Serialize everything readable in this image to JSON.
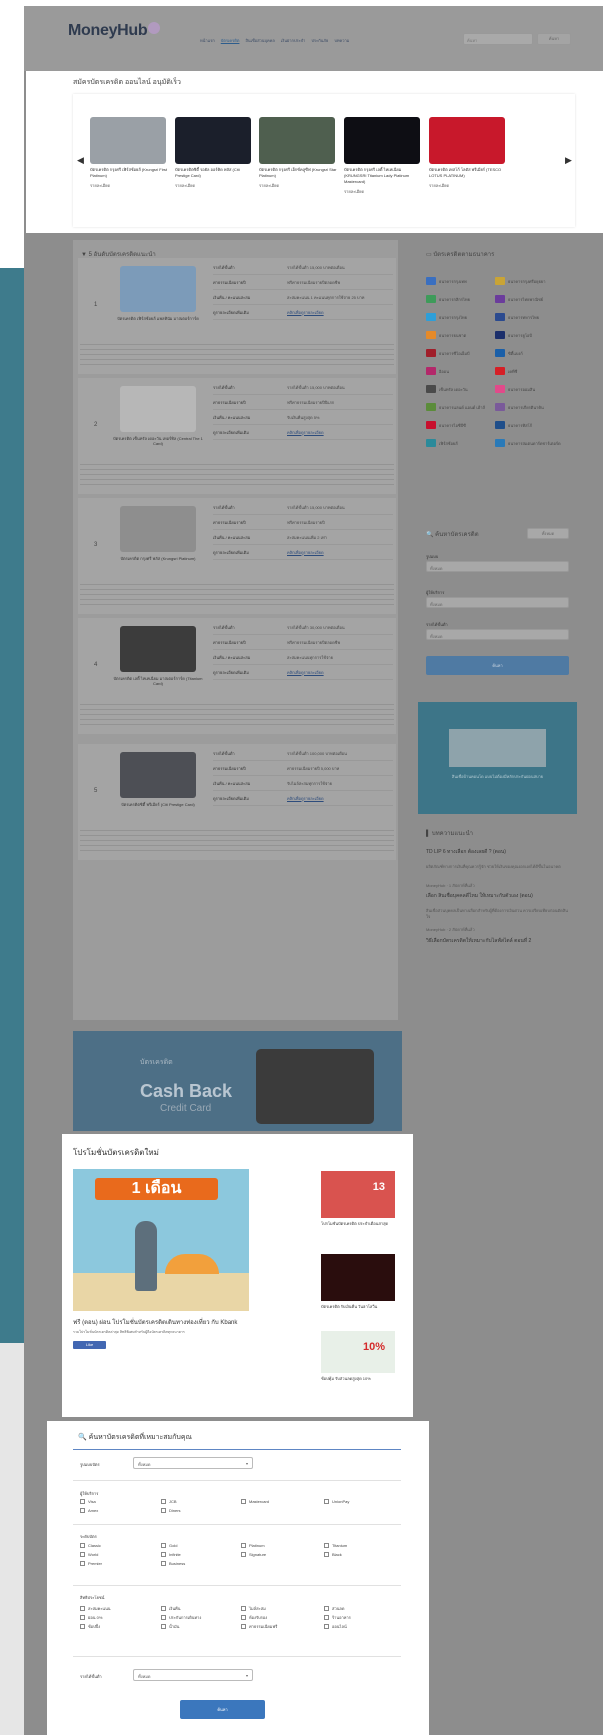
{
  "header": {
    "logo": "MoneyHub",
    "nav": [
      "หน้าแรก",
      "บัตรเครดิต",
      "สินเชื่อส่วนบุคคล",
      "เงินฝากประจำ",
      "ประกันภัย",
      "บทความ"
    ],
    "nav_active": 1,
    "search_placeholder": "ค้นหา",
    "search_button": "ค้นหา"
  },
  "carousel": {
    "title": "สมัครบัตรเครดิต ออนไลน์ อนุมัติเร็ว",
    "detail_label": "รายละเอียด",
    "items": [
      {
        "name": "บัตรเครดิต กรุงศรี เฟิร์สช้อยส์ (Krungsri First Platinum)",
        "color": "#9aa0a6"
      },
      {
        "name": "บัตรเครดิตซิตี้ รอยัล ออร์คิด พลัส (Citi Prestige Card)",
        "color": "#1b1f2b"
      },
      {
        "name": "บัตรเครดิต กรุงศรี เอ็กซ์คลูซีฟ (Krungsri Star Platinum)",
        "color": "#4f5f4f"
      },
      {
        "name": "บัตรเครดิต กรุงศรี เลดี้ ไทเทเนียม (KRUNGSRI Titanium Lady Platinum Mastercard)",
        "color": "#0e0e14"
      },
      {
        "name": "บัตรเครดิต เทสโก้ โลตัส พรีเมียร์ (TESCO LOTUS PLATINUM)",
        "color": "#c8182b"
      }
    ]
  },
  "main": {
    "title": "5 อันดับบัตรเครดิตแนะนำ",
    "row_labels": [
      "รายได้ขั้นต่ำ",
      "ค่าธรรมเนียมรายปี",
      "เงินคืน / คะแนนสะสม",
      "ดูรายละเอียดเพิ่มเติม"
    ],
    "ranks": [
      {
        "num": "1",
        "name": "บัตรเครดิต เฟิร์สช้อยส์ แพลทินัม มาสเตอร์การ์ด",
        "card_color": "#7c9bb9",
        "values": [
          "รายได้ขั้นต่ำ 15,000 บาทต่อเดือน",
          "ฟรีค่าธรรมเนียมรายปีตลอดชีพ",
          "สะสมคะแนน 1 คะแนนทุกการใช้จ่าย 25 บาท",
          "คลิกเพื่อดูรายละเอียด"
        ]
      },
      {
        "num": "2",
        "name": "บัตรเครดิต เซ็นทรัล เดอะวัน เทอร์ทิล (Central The 1 Card)",
        "card_color": "#b7b7b7",
        "values": [
          "รายได้ขั้นต่ำ 15,000 บาทต่อเดือน",
          "ฟรีค่าธรรมเนียมรายปีปีแรก",
          "รับเงินคืนสูงสุด 5%",
          "คลิกเพื่อดูรายละเอียด"
        ]
      },
      {
        "num": "3",
        "name": "บัตรเครดิต กรุงศรี พลัส (Krungsri Platinum)",
        "card_color": "#8e8e8e",
        "values": [
          "รายได้ขั้นต่ำ 15,000 บาทต่อเดือน",
          "ฟรีค่าธรรมเนียมรายปี",
          "สะสมคะแนนเพิ่ม 2 เท่า",
          "คลิกเพื่อดูรายละเอียด"
        ]
      },
      {
        "num": "4",
        "name": "บัตรเครดิต เลดี้ ไทเทเนียม มาสเตอร์การ์ด (Titanium Card)",
        "card_color": "#3c3c3c",
        "values": [
          "รายได้ขั้นต่ำ 30,000 บาทต่อเดือน",
          "ฟรีค่าธรรมเนียมรายปีตลอดชีพ",
          "สะสมคะแนนทุกการใช้จ่าย",
          "คลิกเพื่อดูรายละเอียด"
        ]
      },
      {
        "num": "5",
        "name": "บัตรเครดิตซิตี้ พรีเมียร์ (Citi Prestige Card)",
        "card_color": "#4d4f55",
        "values": [
          "รายได้ขั้นต่ำ 100,000 บาทต่อเดือน",
          "ค่าธรรมเนียมรายปี 5,000 บาท",
          "รับไมล์สะสมทุกการใช้จ่าย",
          "คลิกเพื่อดูรายละเอียด"
        ]
      }
    ]
  },
  "cashback": {
    "small": "บัตรเครดิต",
    "big": "Cash Back",
    "sub": "Credit Card"
  },
  "sidebar": {
    "banks_title": "บัตรเครดิตตามธนาคาร",
    "banks": [
      {
        "name": "ธนาคารกรุงเทพ",
        "color": "#3a6fc0"
      },
      {
        "name": "ธนาคารกรุงศรีอยุธยา",
        "color": "#c9a436"
      },
      {
        "name": "ธนาคารกสิกรไทย",
        "color": "#3e9b5a"
      },
      {
        "name": "ธนาคารไทยพาณิชย์",
        "color": "#6b3c9c"
      },
      {
        "name": "ธนาคารกรุงไทย",
        "color": "#2e9fd9"
      },
      {
        "name": "ธนาคารทหารไทย",
        "color": "#2b4a8f"
      },
      {
        "name": "ธนาคารธนชาต",
        "color": "#e58a2a"
      },
      {
        "name": "ธนาคารยูโอบี",
        "color": "#1c2f6b"
      },
      {
        "name": "ธนาคารซีไอเอ็มบี",
        "color": "#a01e2a"
      },
      {
        "name": "ซิตี้แบงก์",
        "color": "#1a5fa8"
      },
      {
        "name": "อิออน",
        "color": "#b3286a"
      },
      {
        "name": "เคทีซี",
        "color": "#d61f26"
      },
      {
        "name": "เซ็นทรัล เดอะวัน",
        "color": "#4a4a4a"
      },
      {
        "name": "ธนาคารออมสิน",
        "color": "#e24a8a"
      },
      {
        "name": "ธนาคารแลนด์ แอนด์ เฮ้าส์",
        "color": "#5b8c3a"
      },
      {
        "name": "ธนาคารเกียรตินาคิน",
        "color": "#7a5a9a"
      },
      {
        "name": "ธนาคารไอซีบีซี",
        "color": "#c8102e"
      },
      {
        "name": "ธนาคารทิสโก้",
        "color": "#1f4e8a"
      },
      {
        "name": "เฟิร์สช้อยส์",
        "color": "#2b8a9a"
      },
      {
        "name": "ธนาคารสแตนดาร์ดชาร์เตอร์ด",
        "color": "#2a7ab8"
      }
    ],
    "search_title": "ค้นหาบัตรเครดิต",
    "search_all_button": "ทั้งหมด",
    "fields": [
      {
        "label": "รูปแบบ",
        "value": "ทั้งหมด"
      },
      {
        "label": "ผู้ให้บริการ",
        "value": "ทั้งหมด"
      },
      {
        "label": "รายได้ขั้นต่ำ",
        "value": "ทั้งหมด"
      }
    ],
    "search_button": "ค้นหา",
    "ad_text": "สินเชื่อบ้านคอนโด แบบไม่ต้องมีหลักประกันผ่อนสบาย",
    "news_title": "บทความแนะนำ",
    "news": [
      {
        "title": "TD LIP 6 ทางเลือก ต้องเลยดี ? (ตอน)",
        "body": "ผลิตภัณฑ์ทางการเงินที่คุณควรรู้จัก ช่วยให้เงินของคุณงอกเงยได้ดีขึ้นในอนาคต",
        "meta": "MoneyHub · 1 สัปดาห์ที่แล้ว"
      },
      {
        "title": "เลือก สินเชื่อบุคคลดีไหม ให้เหมาะกับตัวเอง (ตอน)",
        "body": "สินเชื่อส่วนบุคคลเป็นทางเลือกสำหรับผู้ที่ต้องการเงินด่วน ควรเปรียบเทียบก่อนตัดสินใจ",
        "meta": "MoneyHub · 2 สัปดาห์ที่แล้ว"
      },
      {
        "title": "วิธีเลือกบัตรเครดิตให้เหมาะกับไลฟ์สไตล์ ตอนที่ 2",
        "body": "",
        "meta": ""
      }
    ]
  },
  "promo": {
    "title": "โปรโมชั่นบัตรเครดิตใหม่",
    "banner": "1 เดือน",
    "headline": "ฟรี (ตอน) ผ่อน โปรโมชั่นบัตรเครดิตเดินทางท่องเที่ยว กับ Kbank",
    "sub": "รวมโปรโมชั่นบัตรเครดิตล่าสุด สิทธิพิเศษสำหรับผู้ถือบัตรเครดิตทุกธนาคาร",
    "like": "Like",
    "thumbs": [
      {
        "caption": "โปรโมชั่นบัตรเครดิต ประจำเดือนล่าสุด",
        "color": "#d9534f",
        "badge": "13"
      },
      {
        "caption": "บัตรเครดิต รับเงินคืน วันฮาโลวีน",
        "color": "#2a0d0d",
        "badge": ""
      },
      {
        "caption": "ช้อปคุ้ม รับส่วนลดสูงสุด 10%",
        "color": "#e8f0e8",
        "badge": "10%"
      }
    ]
  },
  "adv": {
    "title": "ค้นหาบัตรเครดิตที่เหมาะสมกับคุณ",
    "type_label": "รูปแบบบัตร",
    "type_value": "ทั้งหมด",
    "issuer_label": "ผู้ให้บริการ",
    "issuers": [
      "Visa",
      "JCB",
      "Mastercard",
      "UnionPay",
      "Amex",
      "Diners"
    ],
    "level_label": "ระดับบัตร",
    "levels": [
      "Classic",
      "Gold",
      "Platinum",
      "Titanium",
      "World",
      "Infinite",
      "Signature",
      "Black",
      "Premier",
      "Business"
    ],
    "benefit_label": "สิทธิประโยชน์",
    "benefits": [
      "สะสมคะแนน",
      "เงินคืน",
      "ไมล์สะสม",
      "ส่วนลด",
      "ผ่อน 0%",
      "ประกันการเดินทาง",
      "ห้องรับรอง",
      "ร้านอาหาร",
      "ช้อปปิ้ง",
      "น้ำมัน",
      "ค่าธรรมเนียมฟรี",
      "ออนไลน์"
    ],
    "income_label": "รายได้ขั้นต่ำ",
    "income_value": "ทั้งหมด",
    "search_button": "ค้นหา"
  }
}
